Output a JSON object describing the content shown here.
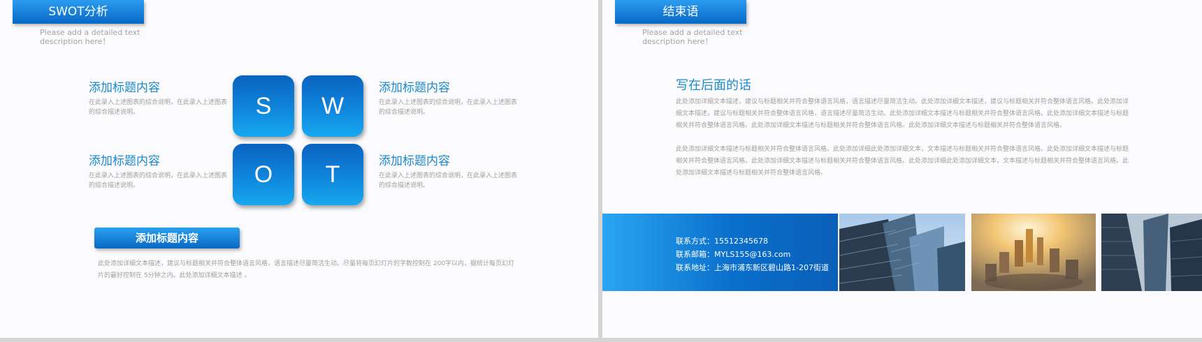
{
  "left_slide": {
    "title": "SWOT分析",
    "subtitle_line1": "Please add a detailed text",
    "subtitle_line2": "description here！",
    "tiles": [
      "S",
      "W",
      "O",
      "T"
    ],
    "items": [
      {
        "title": "添加标题内容",
        "desc": "在此录入上述图表的综合说明，在此录入上述图表的综合描述说明。"
      },
      {
        "title": "添加标题内容",
        "desc": "在此录入上述图表的综合说明，在此录入上述图表的综合描述说明。"
      },
      {
        "title": "添加标题内容",
        "desc": "在此录入上述图表的综合说明，在此录入上述图表的综合描述说明。"
      },
      {
        "title": "添加标题内容",
        "desc": "在此录入上述图表的综合说明，在此录入上述图表的综合描述说明。"
      }
    ],
    "banner_title": "添加标题内容",
    "bottom_text": "此处添加详细文本描述，建议与标题相关并符合整体语言风格，语言描述尽量简洁生动。尽量将每页幻灯片的字数控制在 200字以内，据统计每页幻灯片的最好控制在 5分钟之内。此处添加详细文本描述 。"
  },
  "right_slide": {
    "title": "结束语",
    "subtitle_line1": "Please add a detailed text",
    "subtitle_line2": "description here！",
    "heading": "写在后面的话",
    "para1": "此处添加详细文本描述，建议与标题相关并符合整体语言风格，语言描述尽量简洁生动。此处添加详细文本描述，建议与标题相关并符合整体语言风格。此处添加详细文本描述，建议与标题相关并符合整体语言风格，语言描述尽量简洁生动。此处添加详细文本描述与标题相关并符合整体语言风格。此处添加详细文本描述与标题相关并符合整体语言风格。此处添加详细文本描述与标题相关并符合整体语言风格。此处添加详细文本描述与标题相关并符合整体语言风格。",
    "para2": "此处添加详细文本描述与标题相关并符合整体语言风格。此处添加详细此处添加详细文本，文本描述与标题相关并符合整体语言风格。此处添加详细文本描述与标题相关并符合整体语言风格。此处添加详细文本描述与标题相关并符合整体语言风格。此处添加详细此处添加详细文本，文本描述与标题相关并符合整体语言风格。此处添加详细文本描述与标题相关并符合整体语言风格。",
    "contact": {
      "phone": "联系方式：15512345678",
      "email": "联系邮箱：MYLS155@163.com",
      "address": "联系地址：上海市浦东新区碧山路1-207街道"
    }
  },
  "colors": {
    "accent_blue": "#0a78d8",
    "title_blue": "#1a8acf"
  }
}
